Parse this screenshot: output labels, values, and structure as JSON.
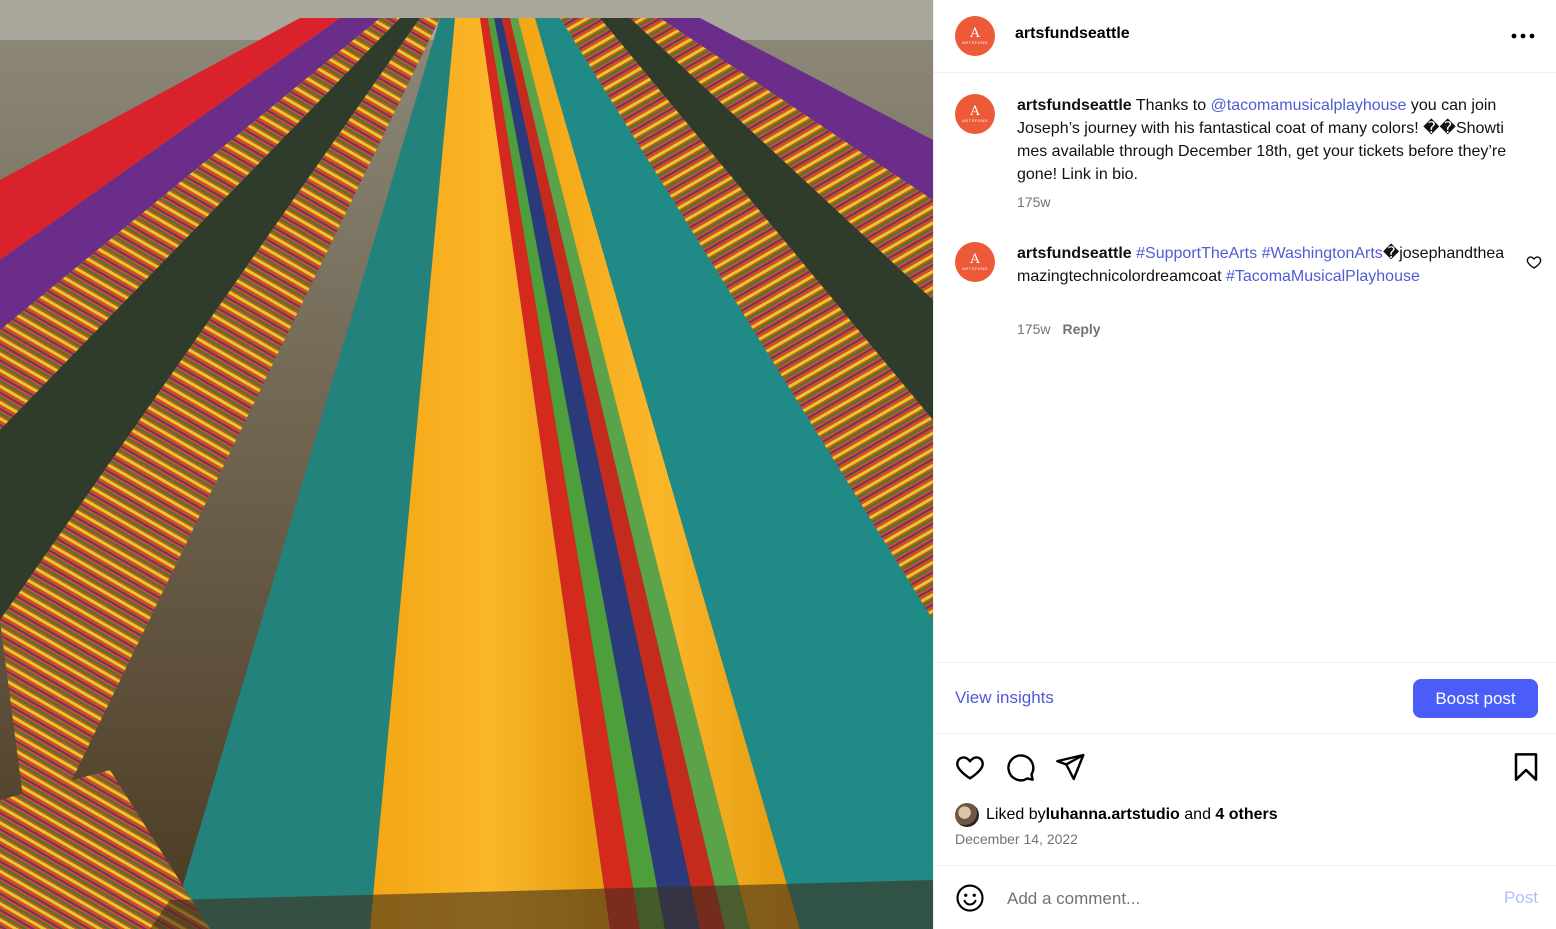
{
  "post": {
    "username": "artsfundseattle",
    "avatar_text": "A",
    "avatar_wordmark": "ARTSFUND",
    "more_label": "•••"
  },
  "caption": {
    "username": "artsfundseattle",
    "text_before": " Thanks to ",
    "mention": "@tacomamusicalplayhouse",
    "text_after": " you can join Joseph’s journey with his fantastical coat of many colors! ��Showtimes available through December 18th, get your tickets before they’re gone! Link in bio.",
    "age": "175w"
  },
  "comment": {
    "username": "artsfundseattle",
    "hashtag1": "#SupportTheArts",
    "hashtag2": "#WashingtonArts",
    "text_mid": "�josephandtheamazingtechnicolordreamcoat ",
    "hashtag3": "#TacomaMusicalPlayhouse",
    "age": "175w",
    "reply_label": "Reply"
  },
  "insights": {
    "view_label": "View insights",
    "boost_label": "Boost post"
  },
  "likes": {
    "prefix": "Liked by ",
    "user": "luhanna.artstudio",
    "middle": " and ",
    "others": "4 others"
  },
  "date": "December 14, 2022",
  "add_comment": {
    "placeholder": "Add a comment...",
    "post_label": "Post"
  },
  "icons": {
    "like": "heart-icon",
    "comment": "comment-bubble-icon",
    "share": "paper-plane-icon",
    "save": "bookmark-icon",
    "emoji": "smiley-icon",
    "more": "more-horizontal-icon"
  },
  "colors": {
    "accent_link": "#4f5bd5",
    "boost_button": "#4a5df9",
    "avatar_brand": "#ec5a37",
    "muted_text": "#737373"
  }
}
